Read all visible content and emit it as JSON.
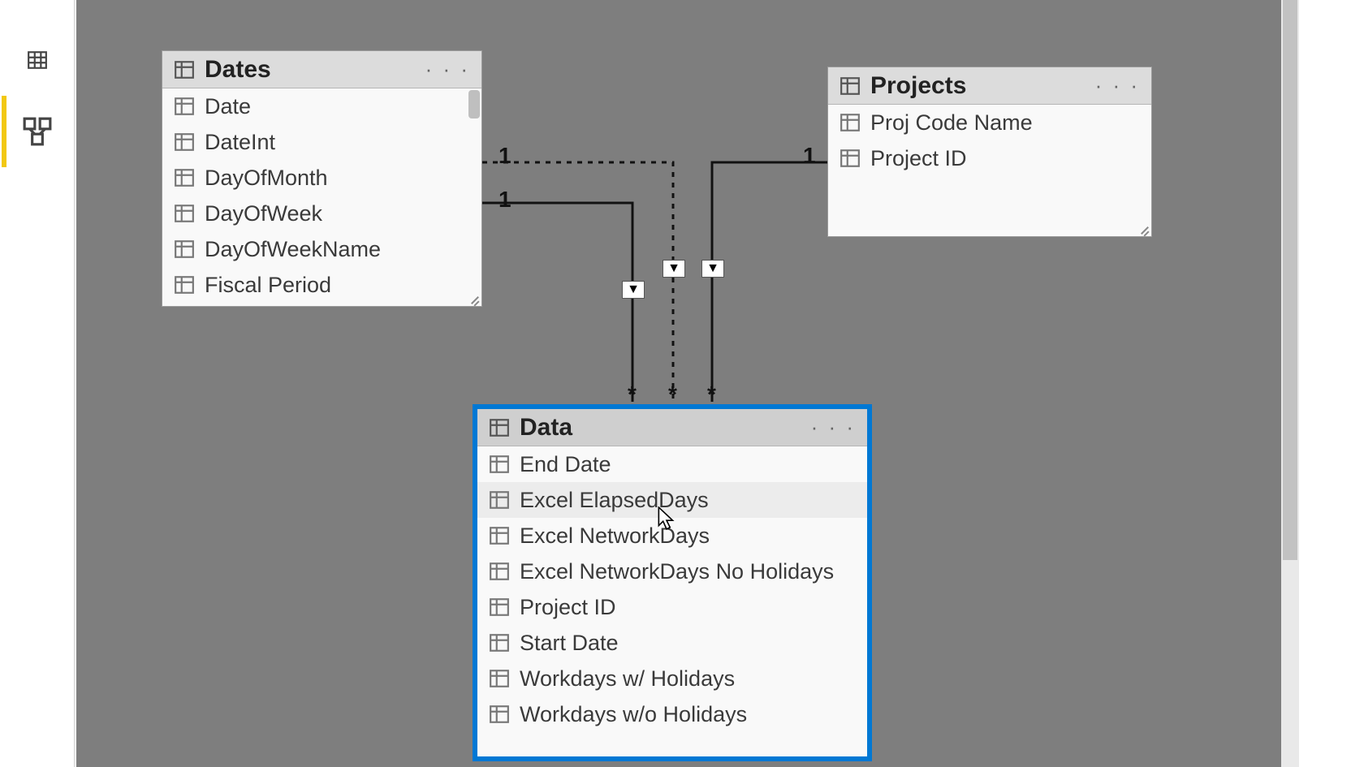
{
  "rail": {
    "active_index": 2
  },
  "tables": {
    "dates": {
      "title": "Dates",
      "fields": [
        "Date",
        "DateInt",
        "DayOfMonth",
        "DayOfWeek",
        "DayOfWeekName",
        "Fiscal Period"
      ]
    },
    "projects": {
      "title": "Projects",
      "fields": [
        "Proj Code Name",
        "Project ID"
      ]
    },
    "data": {
      "title": "Data",
      "fields": [
        "End Date",
        "Excel ElapsedDays",
        "Excel NetworkDays",
        "Excel NetworkDays No Holidays",
        "Project ID",
        "Start Date",
        "Workdays w/ Holidays",
        "Workdays w/o Holidays"
      ],
      "hover_index": 1
    }
  },
  "relationships": [
    {
      "from": "dates",
      "to": "data",
      "from_card": "1",
      "to_card": "*",
      "style": "dashed"
    },
    {
      "from": "dates",
      "to": "data",
      "from_card": "1",
      "to_card": "*",
      "style": "solid"
    },
    {
      "from": "projects",
      "to": "data",
      "from_card": "1",
      "to_card": "*",
      "style": "solid"
    }
  ]
}
